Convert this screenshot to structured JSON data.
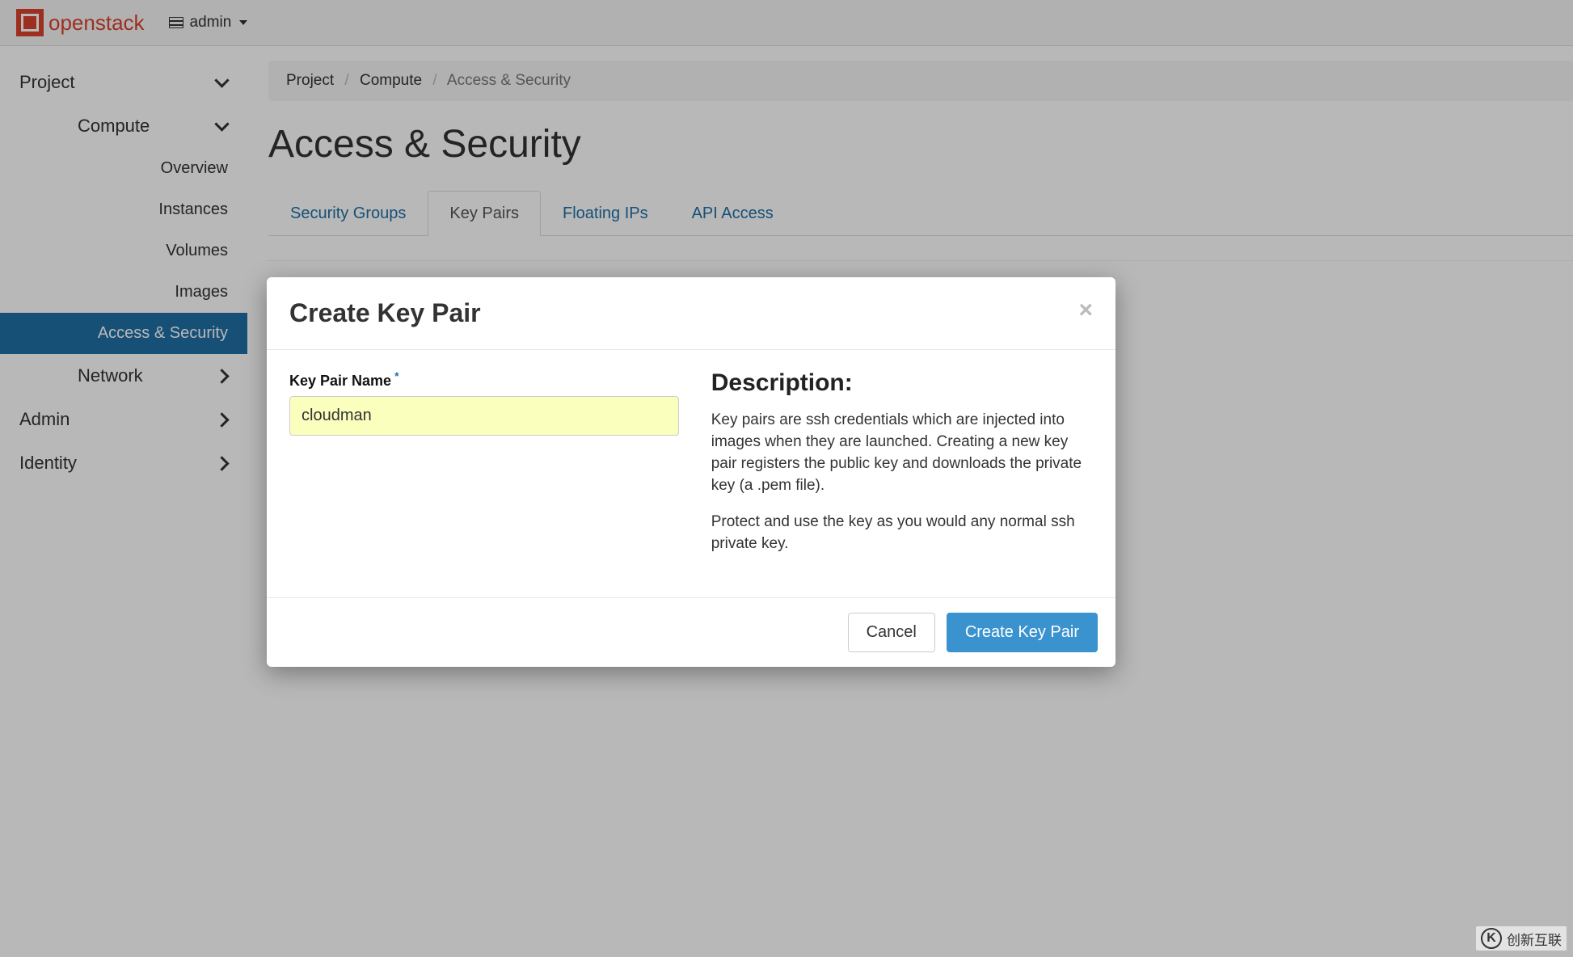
{
  "header": {
    "brand": "openstack",
    "user": "admin"
  },
  "sidebar": {
    "project_label": "Project",
    "compute_label": "Compute",
    "compute_items": {
      "overview": "Overview",
      "instances": "Instances",
      "volumes": "Volumes",
      "images": "Images",
      "access_security": "Access & Security"
    },
    "network_label": "Network",
    "admin_label": "Admin",
    "identity_label": "Identity"
  },
  "breadcrumb": {
    "project": "Project",
    "compute": "Compute",
    "current": "Access & Security"
  },
  "page": {
    "title": "Access & Security",
    "tabs": {
      "security_groups": "Security Groups",
      "key_pairs": "Key Pairs",
      "floating_ips": "Floating IPs",
      "api_access": "API Access"
    }
  },
  "modal": {
    "title": "Create Key Pair",
    "field_label": "Key Pair Name",
    "field_value": "cloudman",
    "desc_title": "Description:",
    "desc_p1": "Key pairs are ssh credentials which are injected into images when they are launched. Creating a new key pair registers the public key and downloads the private key (a .pem file).",
    "desc_p2": "Protect and use the key as you would any normal ssh private key.",
    "cancel": "Cancel",
    "submit": "Create Key Pair"
  },
  "watermark": "创新互联"
}
